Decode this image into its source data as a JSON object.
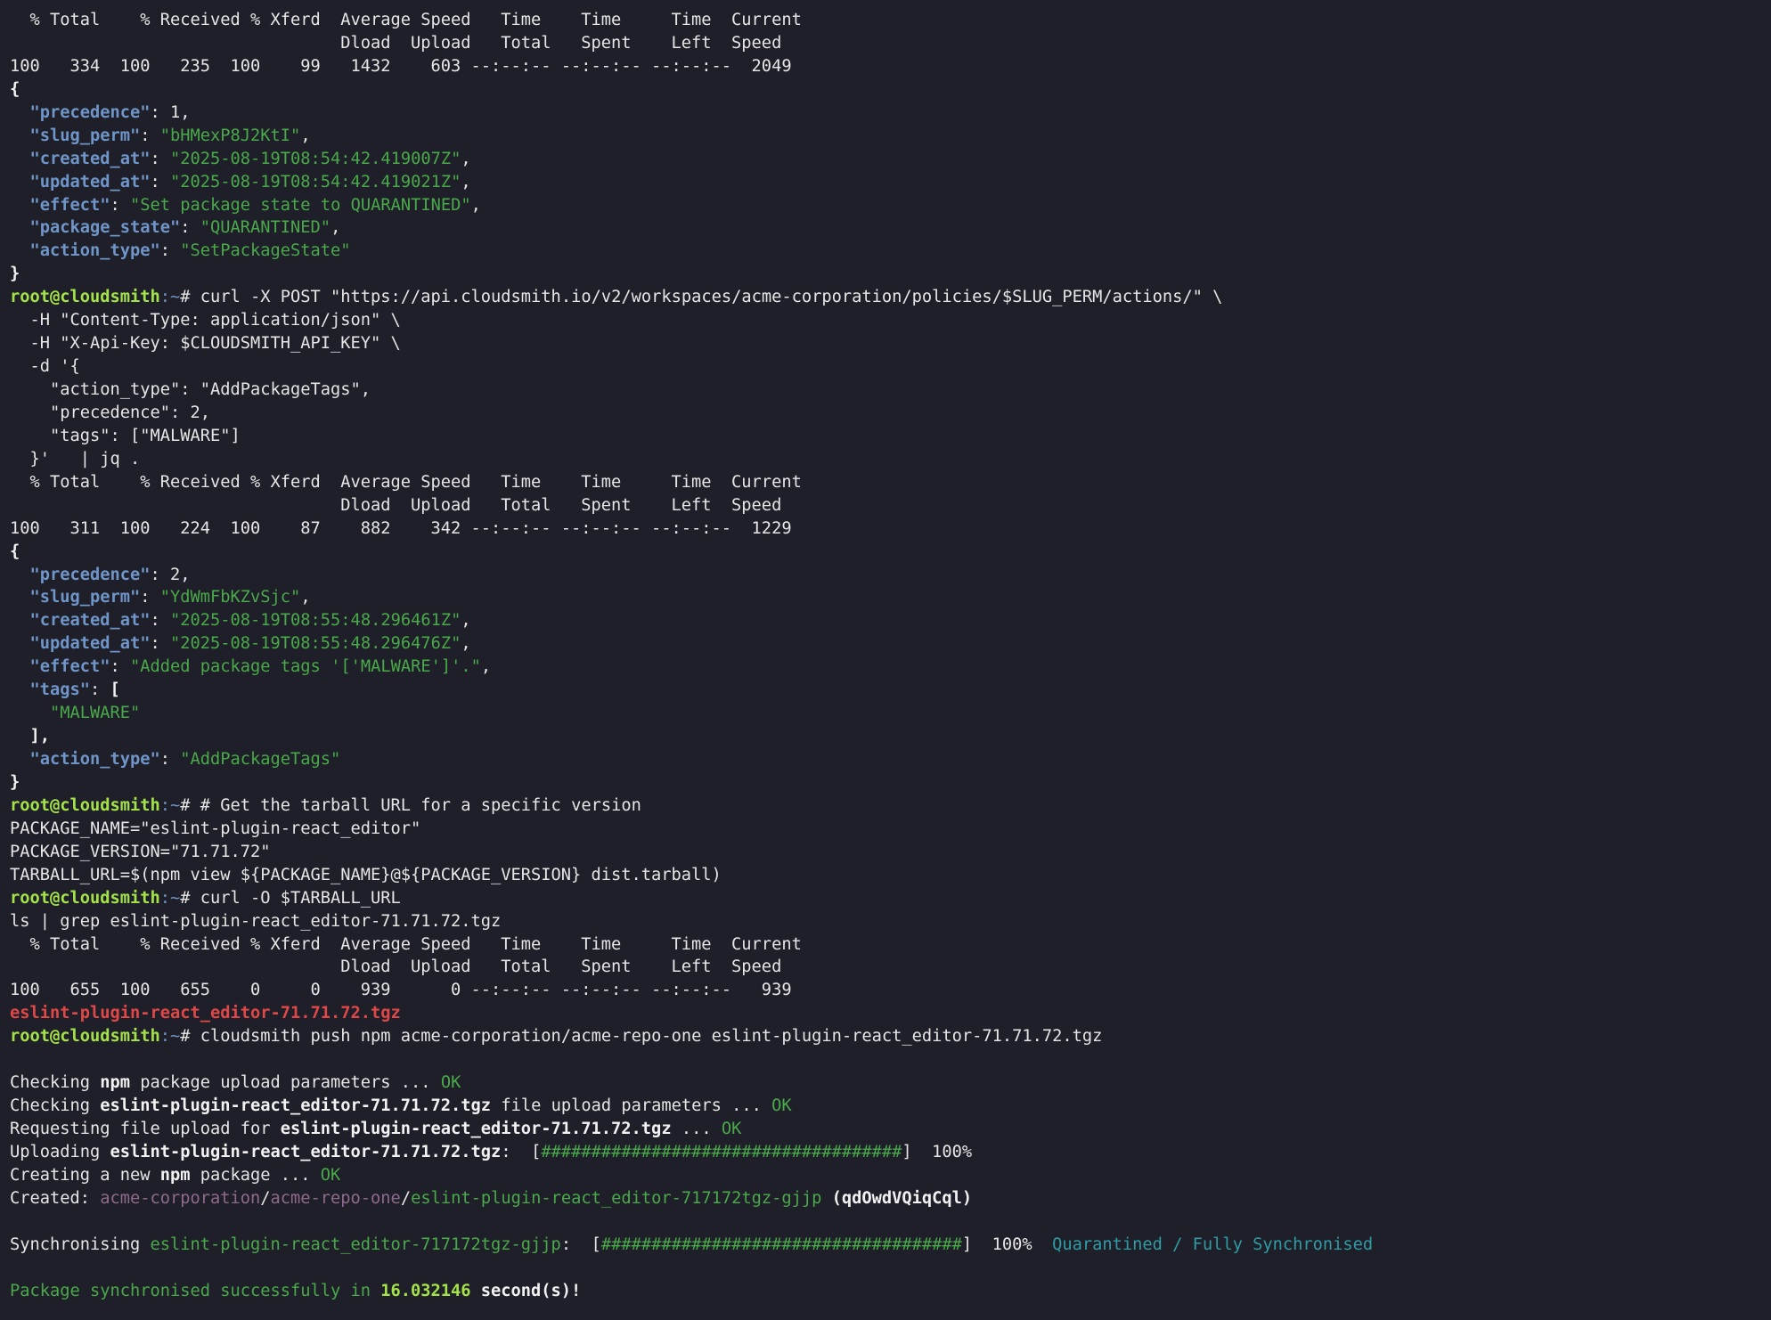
{
  "prompt": {
    "user": "root@cloudsmith",
    "path": ":~# "
  },
  "lines": [
    [
      {
        "c": "t",
        "v": "  % Total    % Received % Xferd  Average Speed   Time    Time     Time  Current"
      }
    ],
    [
      {
        "c": "t",
        "v": "                                 Dload  Upload   Total   Spent    Left  Speed"
      }
    ],
    [
      {
        "c": "t",
        "v": "100   334  100   235  100    99   1432    603 --:--:-- --:--:-- --:--:--  2049"
      }
    ],
    [
      {
        "c": "b",
        "v": "{"
      }
    ],
    [
      {
        "c": "t",
        "v": "  "
      },
      {
        "c": "k",
        "v": "\"precedence\""
      },
      {
        "c": "t",
        "v": ": 1,"
      }
    ],
    [
      {
        "c": "t",
        "v": "  "
      },
      {
        "c": "k",
        "v": "\"slug_perm\""
      },
      {
        "c": "t",
        "v": ": "
      },
      {
        "c": "s",
        "v": "\"bHMexP8J2KtI\""
      },
      {
        "c": "t",
        "v": ","
      }
    ],
    [
      {
        "c": "t",
        "v": "  "
      },
      {
        "c": "k",
        "v": "\"created_at\""
      },
      {
        "c": "t",
        "v": ": "
      },
      {
        "c": "s",
        "v": "\"2025-08-19T08:54:42.419007Z\""
      },
      {
        "c": "t",
        "v": ","
      }
    ],
    [
      {
        "c": "t",
        "v": "  "
      },
      {
        "c": "k",
        "v": "\"updated_at\""
      },
      {
        "c": "t",
        "v": ": "
      },
      {
        "c": "s",
        "v": "\"2025-08-19T08:54:42.419021Z\""
      },
      {
        "c": "t",
        "v": ","
      }
    ],
    [
      {
        "c": "t",
        "v": "  "
      },
      {
        "c": "k",
        "v": "\"effect\""
      },
      {
        "c": "t",
        "v": ": "
      },
      {
        "c": "s",
        "v": "\"Set package state to QUARANTINED\""
      },
      {
        "c": "t",
        "v": ","
      }
    ],
    [
      {
        "c": "t",
        "v": "  "
      },
      {
        "c": "k",
        "v": "\"package_state\""
      },
      {
        "c": "t",
        "v": ": "
      },
      {
        "c": "s",
        "v": "\"QUARANTINED\""
      },
      {
        "c": "t",
        "v": ","
      }
    ],
    [
      {
        "c": "t",
        "v": "  "
      },
      {
        "c": "k",
        "v": "\"action_type\""
      },
      {
        "c": "t",
        "v": ": "
      },
      {
        "c": "s",
        "v": "\"SetPackageState\""
      }
    ],
    [
      {
        "c": "b",
        "v": "}"
      }
    ],
    [
      {
        "c": "pu",
        "v": "root@cloudsmith"
      },
      {
        "c": "pp",
        "v": ":~"
      },
      {
        "c": "t",
        "v": "# curl -X POST \"https://api.cloudsmith.io/v2/workspaces/acme-corporation/policies/$SLUG_PERM/actions/\" \\"
      }
    ],
    [
      {
        "c": "t",
        "v": "  -H \"Content-Type: application/json\" \\"
      }
    ],
    [
      {
        "c": "t",
        "v": "  -H \"X-Api-Key: $CLOUDSMITH_API_KEY\" \\"
      }
    ],
    [
      {
        "c": "t",
        "v": "  -d '{"
      }
    ],
    [
      {
        "c": "t",
        "v": "    \"action_type\": \"AddPackageTags\","
      }
    ],
    [
      {
        "c": "t",
        "v": "    \"precedence\": 2,"
      }
    ],
    [
      {
        "c": "t",
        "v": "    \"tags\": [\"MALWARE\"]"
      }
    ],
    [
      {
        "c": "t",
        "v": "  }'   | jq ."
      }
    ],
    [
      {
        "c": "t",
        "v": "  % Total    % Received % Xferd  Average Speed   Time    Time     Time  Current"
      }
    ],
    [
      {
        "c": "t",
        "v": "                                 Dload  Upload   Total   Spent    Left  Speed"
      }
    ],
    [
      {
        "c": "t",
        "v": "100   311  100   224  100    87    882    342 --:--:-- --:--:-- --:--:--  1229"
      }
    ],
    [
      {
        "c": "b",
        "v": "{"
      }
    ],
    [
      {
        "c": "t",
        "v": "  "
      },
      {
        "c": "k",
        "v": "\"precedence\""
      },
      {
        "c": "t",
        "v": ": 2,"
      }
    ],
    [
      {
        "c": "t",
        "v": "  "
      },
      {
        "c": "k",
        "v": "\"slug_perm\""
      },
      {
        "c": "t",
        "v": ": "
      },
      {
        "c": "s",
        "v": "\"YdWmFbKZvSjc\""
      },
      {
        "c": "t",
        "v": ","
      }
    ],
    [
      {
        "c": "t",
        "v": "  "
      },
      {
        "c": "k",
        "v": "\"created_at\""
      },
      {
        "c": "t",
        "v": ": "
      },
      {
        "c": "s",
        "v": "\"2025-08-19T08:55:48.296461Z\""
      },
      {
        "c": "t",
        "v": ","
      }
    ],
    [
      {
        "c": "t",
        "v": "  "
      },
      {
        "c": "k",
        "v": "\"updated_at\""
      },
      {
        "c": "t",
        "v": ": "
      },
      {
        "c": "s",
        "v": "\"2025-08-19T08:55:48.296476Z\""
      },
      {
        "c": "t",
        "v": ","
      }
    ],
    [
      {
        "c": "t",
        "v": "  "
      },
      {
        "c": "k",
        "v": "\"effect\""
      },
      {
        "c": "t",
        "v": ": "
      },
      {
        "c": "s",
        "v": "\"Added package tags '['MALWARE']'.\""
      },
      {
        "c": "t",
        "v": ","
      }
    ],
    [
      {
        "c": "t",
        "v": "  "
      },
      {
        "c": "k",
        "v": "\"tags\""
      },
      {
        "c": "t",
        "v": ": "
      },
      {
        "c": "b",
        "v": "["
      }
    ],
    [
      {
        "c": "t",
        "v": "    "
      },
      {
        "c": "s",
        "v": "\"MALWARE\""
      }
    ],
    [
      {
        "c": "b",
        "v": "  ],"
      }
    ],
    [
      {
        "c": "t",
        "v": "  "
      },
      {
        "c": "k",
        "v": "\"action_type\""
      },
      {
        "c": "t",
        "v": ": "
      },
      {
        "c": "s",
        "v": "\"AddPackageTags\""
      }
    ],
    [
      {
        "c": "b",
        "v": "}"
      }
    ],
    [
      {
        "c": "pu",
        "v": "root@cloudsmith"
      },
      {
        "c": "pp",
        "v": ":~"
      },
      {
        "c": "t",
        "v": "# # Get the tarball URL for a specific version"
      }
    ],
    [
      {
        "c": "t",
        "v": "PACKAGE_NAME=\"eslint-plugin-react_editor\""
      }
    ],
    [
      {
        "c": "t",
        "v": "PACKAGE_VERSION=\"71.71.72\""
      }
    ],
    [
      {
        "c": "t",
        "v": "TARBALL_URL=$(npm view ${PACKAGE_NAME}@${PACKAGE_VERSION} dist.tarball)"
      }
    ],
    [
      {
        "c": "pu",
        "v": "root@cloudsmith"
      },
      {
        "c": "pp",
        "v": ":~"
      },
      {
        "c": "t",
        "v": "# curl -O $TARBALL_URL"
      }
    ],
    [
      {
        "c": "t",
        "v": "ls | grep eslint-plugin-react_editor-71.71.72.tgz"
      }
    ],
    [
      {
        "c": "t",
        "v": "  % Total    % Received % Xferd  Average Speed   Time    Time     Time  Current"
      }
    ],
    [
      {
        "c": "t",
        "v": "                                 Dload  Upload   Total   Spent    Left  Speed"
      }
    ],
    [
      {
        "c": "t",
        "v": "100   655  100   655    0     0    939      0 --:--:-- --:--:-- --:--:--   939"
      }
    ],
    [
      {
        "c": "red",
        "v": "eslint-plugin-react_editor-71.71.72.tgz"
      }
    ],
    [
      {
        "c": "pu",
        "v": "root@cloudsmith"
      },
      {
        "c": "pp",
        "v": ":~"
      },
      {
        "c": "t",
        "v": "# cloudsmith push npm acme-corporation/acme-repo-one eslint-plugin-react_editor-71.71.72.tgz"
      }
    ],
    [
      {
        "c": "t",
        "v": ""
      }
    ],
    [
      {
        "c": "t",
        "v": "Checking "
      },
      {
        "c": "b",
        "v": "npm"
      },
      {
        "c": "t",
        "v": " package upload parameters ... "
      },
      {
        "c": "ok",
        "v": "OK"
      }
    ],
    [
      {
        "c": "t",
        "v": "Checking "
      },
      {
        "c": "b",
        "v": "eslint-plugin-react_editor-71.71.72.tgz"
      },
      {
        "c": "t",
        "v": " file upload parameters ... "
      },
      {
        "c": "ok",
        "v": "OK"
      }
    ],
    [
      {
        "c": "t",
        "v": "Requesting file upload for "
      },
      {
        "c": "b",
        "v": "eslint-plugin-react_editor-71.71.72.tgz"
      },
      {
        "c": "t",
        "v": " ... "
      },
      {
        "c": "ok",
        "v": "OK"
      }
    ],
    [
      {
        "c": "t",
        "v": "Uploading "
      },
      {
        "c": "b",
        "v": "eslint-plugin-react_editor-71.71.72.tgz"
      },
      {
        "c": "t",
        "v": ":  ["
      },
      {
        "c": "bar",
        "v": "####################################"
      },
      {
        "c": "t",
        "v": "]  100%"
      }
    ],
    [
      {
        "c": "t",
        "v": "Creating a new "
      },
      {
        "c": "b",
        "v": "npm"
      },
      {
        "c": "t",
        "v": " package ... "
      },
      {
        "c": "ok",
        "v": "OK"
      }
    ],
    [
      {
        "c": "t",
        "v": "Created: "
      },
      {
        "c": "muted",
        "v": "acme-corporation"
      },
      {
        "c": "t",
        "v": "/"
      },
      {
        "c": "muted",
        "v": "acme-repo-one"
      },
      {
        "c": "t",
        "v": "/"
      },
      {
        "c": "grn",
        "v": "eslint-plugin-react_editor-717172tgz-gjjp"
      },
      {
        "c": "t",
        "v": " "
      },
      {
        "c": "b",
        "v": "(qdOwdVQiqCql)"
      }
    ],
    [
      {
        "c": "t",
        "v": ""
      }
    ],
    [
      {
        "c": "t",
        "v": "Synchronising "
      },
      {
        "c": "grn",
        "v": "eslint-plugin-react_editor-717172tgz-gjjp"
      },
      {
        "c": "t",
        "v": ":  ["
      },
      {
        "c": "bar",
        "v": "####################################"
      },
      {
        "c": "t",
        "v": "]  100%  "
      },
      {
        "c": "cyan",
        "v": "Quarantined / Fully Synchronised"
      }
    ],
    [
      {
        "c": "t",
        "v": ""
      }
    ],
    [
      {
        "c": "grn",
        "v": "Package synchronised successfully in "
      },
      {
        "c": "time",
        "v": "16.032146"
      },
      {
        "c": "b",
        "v": " second(s)!"
      }
    ]
  ]
}
